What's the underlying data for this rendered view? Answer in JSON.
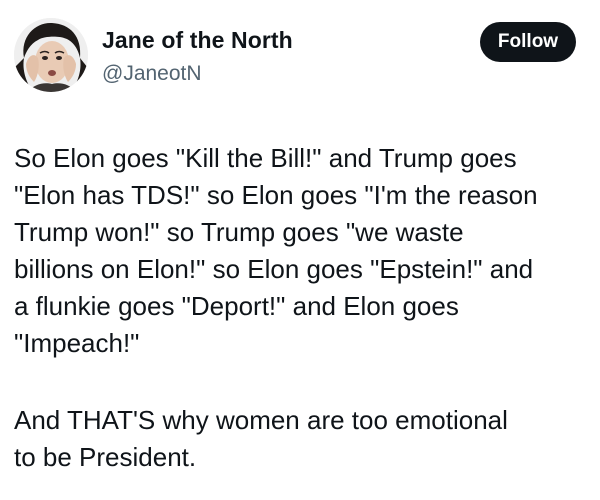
{
  "author": {
    "display_name": "Jane of the North",
    "handle": "@JaneotN",
    "avatar_icon": "portrait-avatar"
  },
  "follow_label": "Follow",
  "tweet": {
    "paragraph1": "So Elon goes \"Kill the Bill!\" and Trump goes\n\"Elon has TDS!\" so Elon goes \"I'm the reason\nTrump won!\" so Trump goes \"we waste\nbillions on Elon!\" so Elon goes \"Epstein!\" and\na flunkie goes \"Deport!\" and Elon goes\n\"Impeach!\"",
    "paragraph2": "And THAT'S why women are too emotional\nto be President."
  },
  "colors": {
    "text": "#0f1419",
    "secondary": "#536471",
    "button_bg": "#0f1419",
    "button_text": "#ffffff"
  }
}
